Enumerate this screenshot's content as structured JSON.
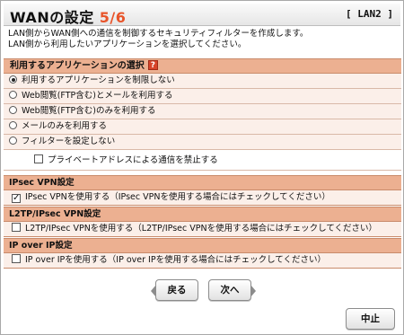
{
  "header": {
    "title_prefix": "WANの設定 ",
    "step": "5/6",
    "interface": "[ LAN2 ]"
  },
  "description": {
    "line1": "LAN側からWAN側への通信を制御するセキュリティフィルターを作成します。",
    "line2": "LAN側から利用したいアプリケーションを選択してください。"
  },
  "app_section": {
    "title": "利用するアプリケーションの選択",
    "help_icon": "?",
    "options": [
      {
        "label": "利用するアプリケーションを制限しない",
        "selected": true
      },
      {
        "label": "Web閲覧(FTP含む)とメールを利用する",
        "selected": false
      },
      {
        "label": "Web閲覧(FTP含む)のみを利用する",
        "selected": false
      },
      {
        "label": "メールのみを利用する",
        "selected": false
      },
      {
        "label": "フィルターを設定しない",
        "selected": false
      }
    ],
    "private_address": {
      "label": "プライベートアドレスによる通信を禁止する",
      "checked": false
    }
  },
  "ipsec": {
    "title": "IPsec VPN設定",
    "label": "IPsec VPNを使用する（IPsec VPNを使用する場合にはチェックしてください）",
    "checked": true
  },
  "l2tp": {
    "title": "L2TP/IPsec VPN設定",
    "label": "L2TP/IPsec VPNを使用する（L2TP/IPsec VPNを使用する場合にはチェックしてください）",
    "checked": false
  },
  "ipoverip": {
    "title": "IP over IP設定",
    "label": "IP over IPを使用する（IP over IPを使用する場合にはチェックしてください）",
    "checked": false
  },
  "buttons": {
    "back": "戻る",
    "next": "次へ",
    "cancel": "中止"
  }
}
